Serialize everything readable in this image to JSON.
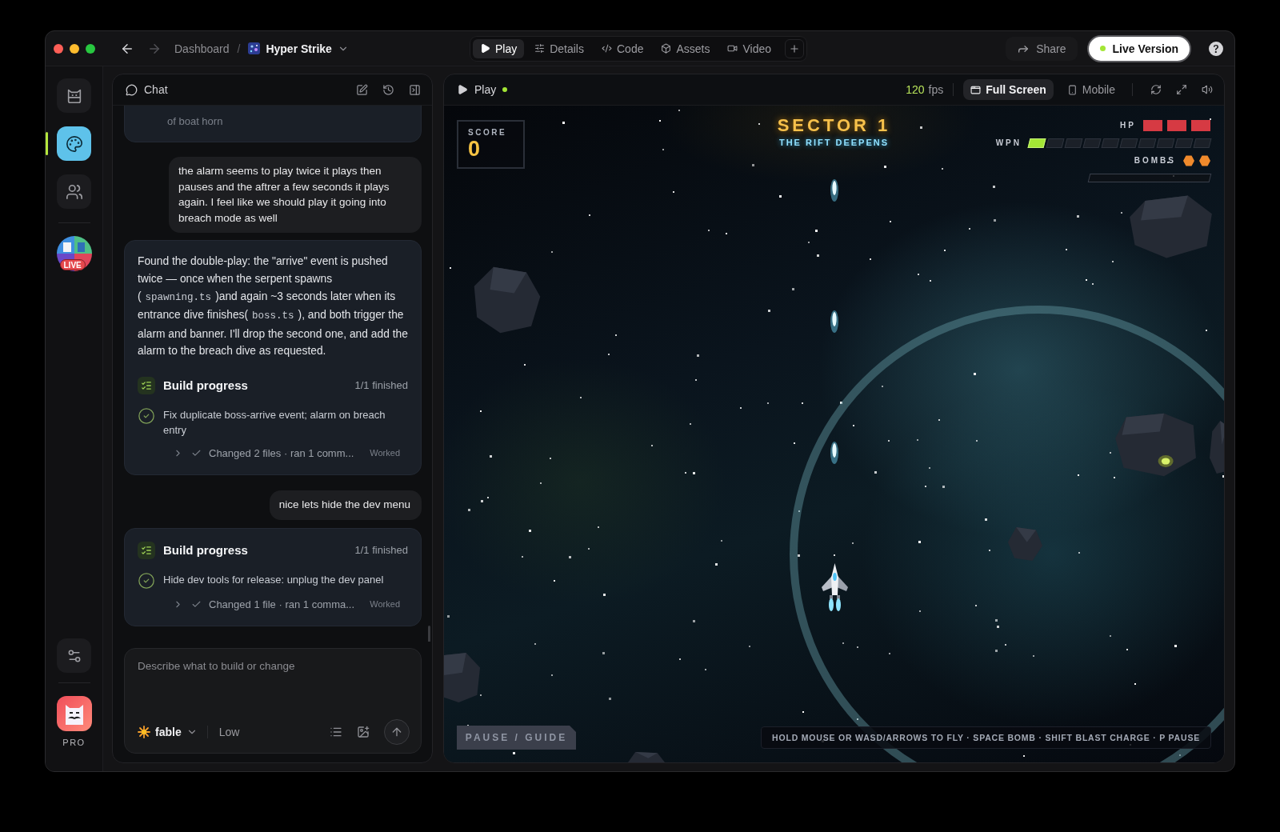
{
  "titlebar": {
    "nav": {
      "back": {
        "disabled": false
      },
      "forward": {
        "disabled": true
      }
    },
    "breadcrumb": {
      "root": "Dashboard",
      "separator": "/",
      "project": "Hyper Strike"
    },
    "tabs": [
      {
        "label": "Play",
        "selected": true
      },
      {
        "label": "Details",
        "selected": false
      },
      {
        "label": "Code",
        "selected": false
      },
      {
        "label": "Assets",
        "selected": false
      },
      {
        "label": "Video",
        "selected": false
      }
    ],
    "share": "Share",
    "live_version": {
      "label": "Live Version",
      "online": true
    }
  },
  "rail": {
    "items": [
      {
        "selected": false
      },
      {
        "selected": true
      },
      {
        "selected": false
      }
    ],
    "live_badge": "LIVE",
    "plan": "PRO"
  },
  "chat": {
    "title": "Chat",
    "messages": [
      {
        "kind": "build_tail",
        "text": "of boat horn"
      },
      {
        "kind": "user",
        "text": "the alarm seems to play twice it plays then pauses and the aftrer a few seconds it plays again. I feel like we should play it going into breach mode as well"
      },
      {
        "kind": "assistant",
        "paragraph": [
          {
            "kind": "text",
            "text": "Found the double-play: the \"arrive\" event is pushed twice — once when the serpent spawns ("
          },
          {
            "kind": "code",
            "text": "spawning.ts"
          },
          {
            "kind": "text",
            "text": ")and again ~3 seconds later when its entrance dive finishes("
          },
          {
            "kind": "code",
            "text": "boss.ts"
          },
          {
            "kind": "text",
            "text": "), and both trigger the alarm and banner. I'll drop the second one, and add the alarm to the breach dive as requested."
          }
        ],
        "build": {
          "title": "Build progress",
          "status": "1/1 finished",
          "tasks": [
            {
              "text": "Fix duplicate boss-arrive event; alarm on breach entry",
              "done": true,
              "detail": {
                "expanded": false,
                "text": "Changed 2 files · ran 1 comm...",
                "result": "Worked"
              }
            }
          ]
        }
      },
      {
        "kind": "user",
        "text": "nice lets hide the dev menu"
      },
      {
        "kind": "build",
        "build": {
          "title": "Build progress",
          "status": "1/1 finished",
          "tasks": [
            {
              "text": "Hide dev tools for release: unplug the dev panel",
              "done": true,
              "detail": {
                "expanded": false,
                "text": "Changed 1 file · ran 1 comma...",
                "result": "Worked"
              }
            }
          ]
        }
      }
    ],
    "composer": {
      "placeholder": "Describe what to build or change",
      "model": "fable",
      "effort": "Low"
    }
  },
  "game": {
    "header": {
      "title": "Play",
      "running": true,
      "fps": "120",
      "fps_unit": "fps",
      "views": [
        {
          "label": "Full Screen",
          "selected": true
        },
        {
          "label": "Mobile",
          "selected": false
        }
      ]
    },
    "hud": {
      "score_label": "SCORE",
      "score": "0",
      "sector": "SECTOR 1",
      "subtitle": "THE RIFT DEEPENS",
      "hp": {
        "label": "HP",
        "pips": [
          {
            "filled": true
          },
          {
            "filled": true
          },
          {
            "filled": true
          }
        ]
      },
      "wpn": {
        "label": "WPN",
        "pips": [
          {
            "filled": true
          },
          {
            "filled": false
          },
          {
            "filled": false
          },
          {
            "filled": false
          },
          {
            "filled": false
          },
          {
            "filled": false
          },
          {
            "filled": false
          },
          {
            "filled": false
          },
          {
            "filled": false
          },
          {
            "filled": false
          }
        ]
      },
      "bombs": {
        "label": "BOMBS",
        "pips": [
          {
            "filled": true
          },
          {
            "filled": true
          }
        ]
      },
      "charge": {
        "level": 0
      }
    },
    "pause_button": "PAUSE / GUIDE",
    "controls_hint": "HOLD MOUSE OR WASD/ARROWS TO FLY · SPACE BOMB · SHIFT BLAST CHARGE · P PAUSE"
  }
}
